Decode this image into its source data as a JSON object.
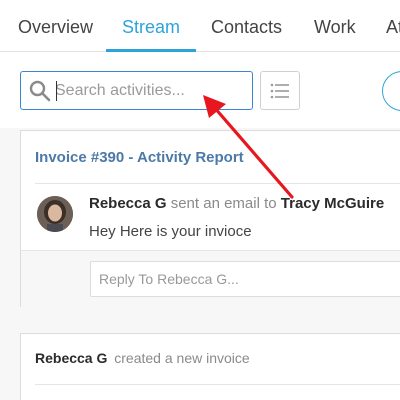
{
  "tabs": [
    {
      "label": "Overview",
      "active": false
    },
    {
      "label": "Stream",
      "active": true
    },
    {
      "label": "Contacts",
      "active": false
    },
    {
      "label": "Work",
      "active": false
    },
    {
      "label": "At",
      "active": false
    }
  ],
  "search": {
    "placeholder": "Search activities...",
    "value": "",
    "icon": "search-icon"
  },
  "toolbar": {
    "list_icon": "list-icon"
  },
  "activity_card": {
    "title": "Invoice #390 - Activity Report",
    "actor": "Rebecca G",
    "action": "sent an email to",
    "recipient": "Tracy McGuire",
    "message": "Hey Here is your invioce",
    "reply_placeholder": "Reply To Rebecca  G..."
  },
  "second_card": {
    "actor": "Rebecca G",
    "action": "created a new invoice"
  },
  "colors": {
    "accent": "#2ea3db",
    "card_title": "#4b7aa8",
    "annotation_arrow": "#e8171f"
  }
}
